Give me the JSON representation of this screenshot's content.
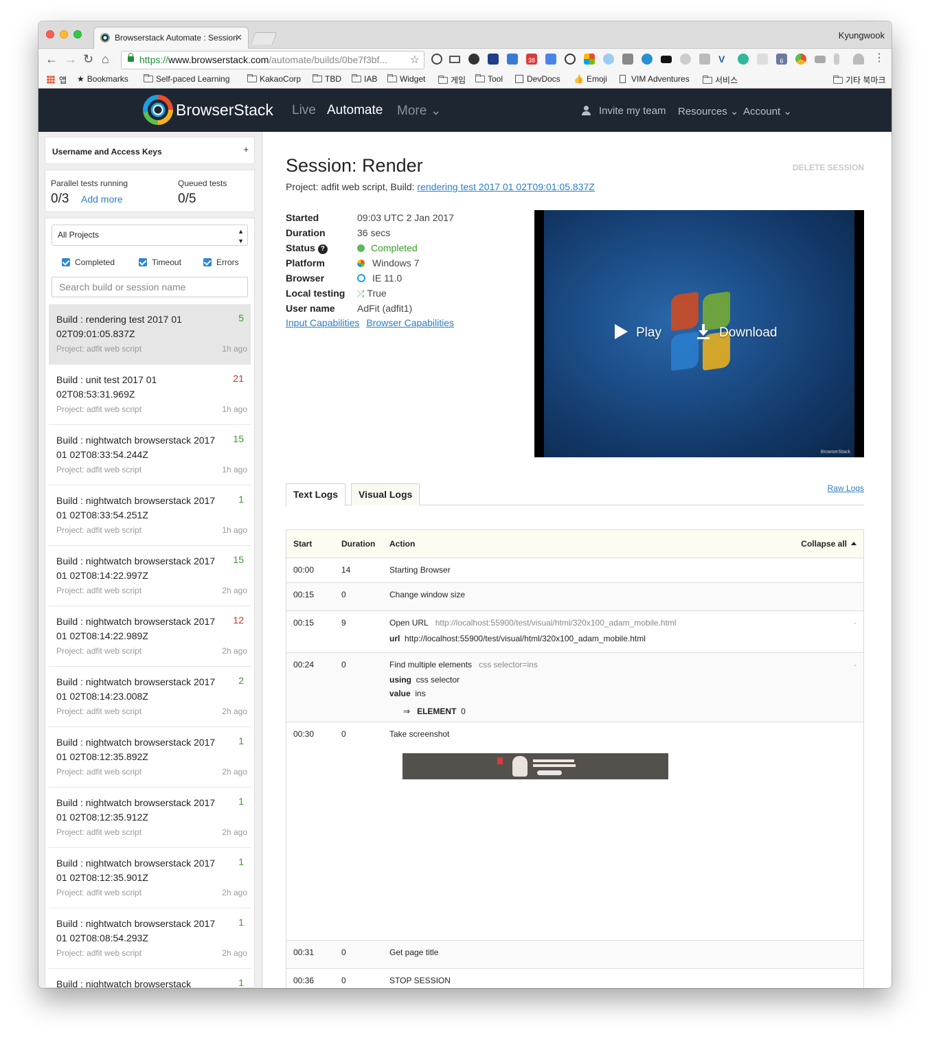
{
  "browser": {
    "tab_title": "Browserstack Automate : Session",
    "tab_close": "✕",
    "profile": "Kyungwook",
    "url_scheme": "https://",
    "url_host": "www.browserstack.com",
    "url_path": "/automate/builds/0be7f3bf...",
    "nav": {
      "back": "←",
      "forward": "→",
      "reload": "↻",
      "home": "⌂",
      "star": "☆",
      "menu": "⋮"
    },
    "bookmarks": [
      {
        "label": "앱",
        "icon": "apps-icon"
      },
      {
        "label": "Bookmarks",
        "icon": "star-icon"
      },
      {
        "label": "Self-paced Learning",
        "icon": "folder-icon"
      },
      {
        "label": "KakaoCorp",
        "icon": "folder-icon"
      },
      {
        "label": "TBD",
        "icon": "folder-icon"
      },
      {
        "label": "IAB",
        "icon": "folder-icon"
      },
      {
        "label": "Widget",
        "icon": "folder-icon"
      },
      {
        "label": "게임",
        "icon": "folder-icon"
      },
      {
        "label": "Tool",
        "icon": "folder-icon"
      },
      {
        "label": "DevDocs",
        "icon": "search-icon"
      },
      {
        "label": "Emoji",
        "icon": "thumb-icon"
      },
      {
        "label": "VIM Adventures",
        "icon": "page-icon"
      },
      {
        "label": "서비스",
        "icon": "folder-icon"
      },
      {
        "label": "기타 북마크",
        "icon": "folder-icon"
      }
    ],
    "ext_badges": {
      "mail": "38",
      "six": "6"
    }
  },
  "header": {
    "brand": "BrowserStack",
    "nav_live": "Live",
    "nav_automate": "Automate",
    "nav_more": "More ⌄",
    "invite": "Invite my team",
    "resources": "Resources ⌄",
    "account": "Account ⌄"
  },
  "sidebar": {
    "keys_title": "Username and Access Keys",
    "keys_toggle": "+",
    "parallel_label": "Parallel tests running",
    "parallel_value": "0/3",
    "add_more": "Add more",
    "queued_label": "Queued tests",
    "queued_value": "0/5",
    "project_select": "All Projects",
    "filters": [
      "Completed",
      "Timeout",
      "Errors"
    ],
    "search_placeholder": "Search build or session name",
    "builds": [
      {
        "name": "Build : rendering test 2017 01 02T09:01:05.837Z",
        "count": "5",
        "status": "green",
        "project": "Project: adfit web script",
        "time": "1h ago"
      },
      {
        "name": "Build : unit test 2017 01 02T08:53:31.969Z",
        "count": "21",
        "status": "red",
        "project": "Project: adfit web script",
        "time": "1h ago"
      },
      {
        "name": "Build : nightwatch browserstack 2017 01 02T08:33:54.244Z",
        "count": "15",
        "status": "green",
        "project": "Project: adfit web script",
        "time": "1h ago"
      },
      {
        "name": "Build : nightwatch browserstack 2017 01 02T08:33:54.251Z",
        "count": "1",
        "status": "green",
        "project": "Project: adfit web script",
        "time": "1h ago"
      },
      {
        "name": "Build : nightwatch browserstack 2017 01 02T08:14:22.997Z",
        "count": "15",
        "status": "green",
        "project": "Project: adfit web script",
        "time": "2h ago"
      },
      {
        "name": "Build : nightwatch browserstack 2017 01 02T08:14:22.989Z",
        "count": "12",
        "status": "red",
        "project": "Project: adfit web script",
        "time": "2h ago"
      },
      {
        "name": "Build : nightwatch browserstack 2017 01 02T08:14:23.008Z",
        "count": "2",
        "status": "green",
        "project": "Project: adfit web script",
        "time": "2h ago"
      },
      {
        "name": "Build : nightwatch browserstack 2017 01 02T08:12:35.892Z",
        "count": "1",
        "status": "green",
        "project": "Project: adfit web script",
        "time": "2h ago"
      },
      {
        "name": "Build : nightwatch browserstack 2017 01 02T08:12:35.912Z",
        "count": "1",
        "status": "green",
        "project": "Project: adfit web script",
        "time": "2h ago"
      },
      {
        "name": "Build : nightwatch browserstack 2017 01 02T08:12:35.901Z",
        "count": "1",
        "status": "green",
        "project": "Project: adfit web script",
        "time": "2h ago"
      },
      {
        "name": "Build : nightwatch browserstack 2017 01 02T08:08:54.293Z",
        "count": "1",
        "status": "green",
        "project": "Project: adfit web script",
        "time": "2h ago"
      },
      {
        "name": "Build : nightwatch browserstack",
        "count": "1",
        "status": "green",
        "project": "",
        "time": ""
      }
    ]
  },
  "session": {
    "title": "Session: Render",
    "delete": "DELETE SESSION",
    "project_prefix": "Project: adfit web script, Build: ",
    "build_link": "rendering test 2017 01 02T09:01:05.837Z",
    "details": {
      "started_label": "Started",
      "started": "09:03 UTC 2 Jan 2017",
      "duration_label": "Duration",
      "duration": "36 secs",
      "status_label": "Status",
      "status_help": "?",
      "status": "Completed",
      "platform_label": "Platform",
      "platform": "Windows 7",
      "browser_label": "Browser",
      "browser": "IE 11.0",
      "local_label": "Local testing",
      "local": "True",
      "user_label": "User name",
      "user": "AdFit (adfit1)"
    },
    "input_caps": "Input Capabilities",
    "browser_caps": "Browser Capabilities",
    "video": {
      "play": "Play",
      "download": "Download",
      "watermark": "BrowserStack"
    }
  },
  "logs": {
    "tab_text": "Text Logs",
    "tab_visual": "Visual Logs",
    "raw": "Raw Logs",
    "head": {
      "start": "Start",
      "duration": "Duration",
      "action": "Action",
      "collapse": "Collapse all"
    },
    "rows": [
      {
        "start": "00:00",
        "duration": "14",
        "action": "Starting Browser"
      },
      {
        "start": "00:15",
        "duration": "0",
        "action": "Change window size"
      },
      {
        "start": "00:15",
        "duration": "9",
        "action": "Open URL",
        "extra": "http://localhost:55900/test/visual/html/320x100_adam_mobile.html",
        "p1k": "url",
        "p1v": "http://localhost:55900/test/visual/html/320x100_adam_mobile.html",
        "dash": "-"
      },
      {
        "start": "00:24",
        "duration": "0",
        "action": "Find multiple elements",
        "extra": "css selector=ins",
        "p1k": "using",
        "p1v": "css selector",
        "p2k": "value",
        "p2v": "ins",
        "arrow": "⇒",
        "resk": "ELEMENT",
        "resv": "0",
        "dash": "-"
      },
      {
        "start": "00:30",
        "duration": "0",
        "action": "Take screenshot"
      },
      {
        "start": "00:31",
        "duration": "0",
        "action": "Get page title"
      },
      {
        "start": "00:36",
        "duration": "0",
        "action": "STOP SESSION"
      }
    ]
  }
}
